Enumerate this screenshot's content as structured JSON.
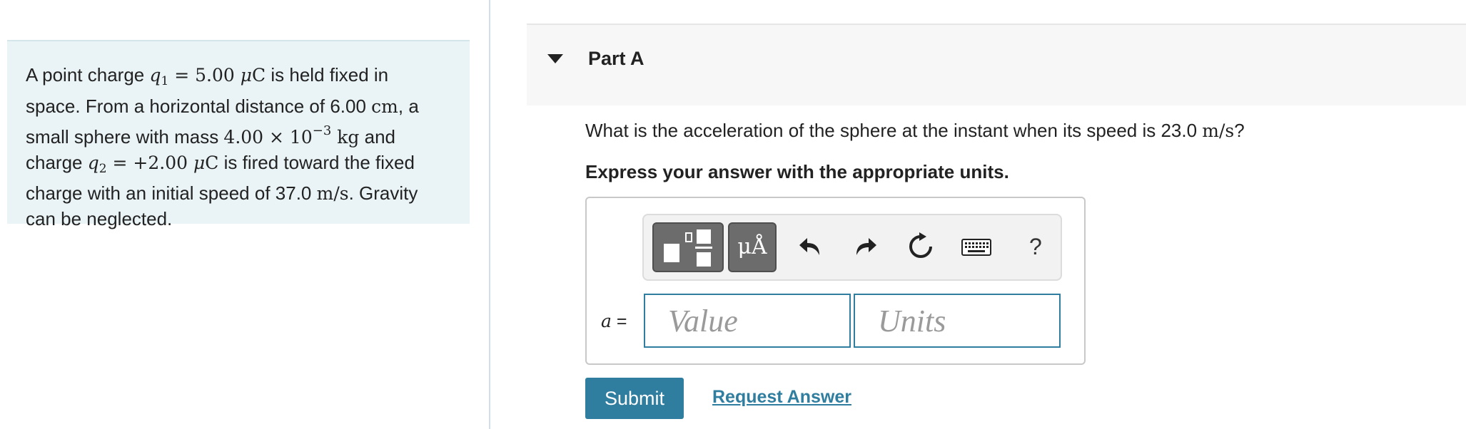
{
  "problem": {
    "t1": "A point charge ",
    "q1": "q",
    "q1_sub": "1",
    "t2": " = 5.00 ",
    "mu1": "μ",
    "C1": "C",
    "t3": " is held fixed in",
    "t4": "space. From a horizontal distance of 6.00 ",
    "cm": "cm",
    "t5": ", a",
    "t6": "small sphere with mass ",
    "mass": "4.00 × 10",
    "exp": "−3",
    "kg": " kg",
    "t7": " and",
    "t8": "charge ",
    "q2": "q",
    "q2_sub": "2",
    "t9": " = +2.00 ",
    "mu2": "μ",
    "C2": "C",
    "t10": " is fired toward the fixed",
    "t11": "charge with an initial speed of 37.0 ",
    "ms": "m/s",
    "t12": ". Gravity",
    "t13": "can be neglected."
  },
  "part": {
    "title": "Part A"
  },
  "question": {
    "pre": "What is the acceleration of the sphere at the instant when its speed is 23.0 ",
    "unit": "m/s",
    "post": "?"
  },
  "instruction": "Express your answer with the appropriate units.",
  "toolbar": {
    "symbols_label": "μÅ",
    "help_label": "?"
  },
  "answer": {
    "variable": "a",
    "equals": " =",
    "value_placeholder": "Value",
    "units_placeholder": "Units"
  },
  "actions": {
    "submit_label": "Submit",
    "request_label": "Request Answer"
  },
  "colors": {
    "accent": "#2f7ea0",
    "panel_bg": "#eaf4f6",
    "button_gray": "#6c6c6c"
  }
}
